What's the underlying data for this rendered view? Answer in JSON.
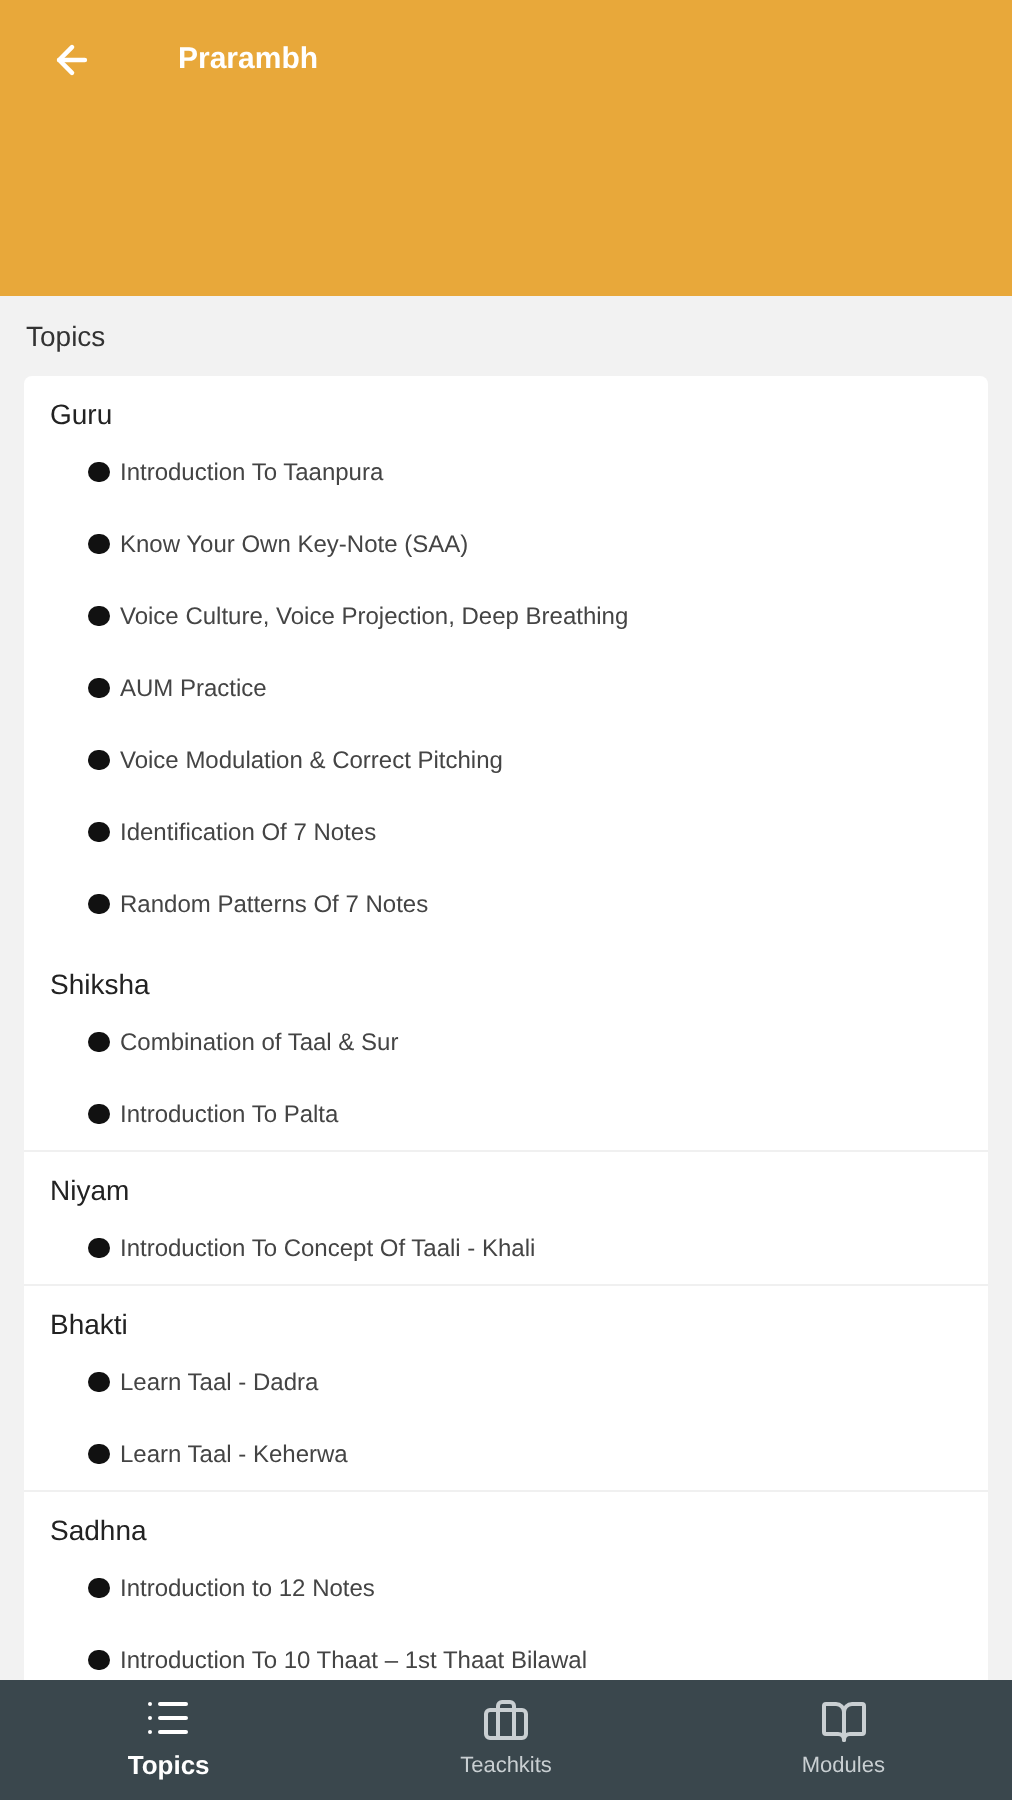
{
  "app_bar": {
    "title": "Prarambh"
  },
  "section_label": "Topics",
  "groups": [
    {
      "title": "Guru",
      "items": [
        "Introduction To Taanpura",
        "Know Your Own Key-Note (SAA)",
        "Voice Culture, Voice Projection, Deep Breathing",
        "AUM Practice",
        "Voice Modulation & Correct Pitching",
        "Identification Of 7 Notes",
        "Random Patterns Of 7 Notes"
      ]
    },
    {
      "title": "Shiksha",
      "items": [
        "Combination of Taal & Sur",
        "Introduction To Palta"
      ]
    },
    {
      "title": "Niyam",
      "items": [
        "Introduction To Concept Of Taali - Khali"
      ]
    },
    {
      "title": "Bhakti",
      "items": [
        "Learn Taal - Dadra",
        "Learn Taal - Keherwa"
      ]
    },
    {
      "title": "Sadhna",
      "items": [
        "Introduction to 12 Notes",
        "Introduction To 10 Thaat  – 1st Thaat Bilawal"
      ]
    }
  ],
  "bottom_nav": [
    {
      "kind": "list",
      "label": "Topics",
      "selected": true
    },
    {
      "kind": "briefcase",
      "label": "Teachkits",
      "selected": false
    },
    {
      "kind": "book",
      "label": "Modules",
      "selected": false
    }
  ]
}
